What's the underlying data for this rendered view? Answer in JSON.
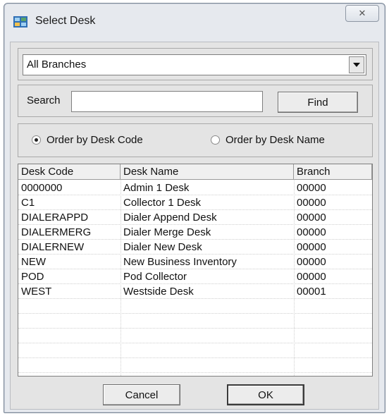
{
  "window": {
    "title": "Select Desk",
    "close_symbol": "✕",
    "app_icon": "desk-app-icon"
  },
  "branch_select": {
    "selected": "All Branches",
    "arrow_icon": "dropdown-arrow-icon"
  },
  "search": {
    "label": "Search",
    "value": "",
    "find_label": "Find"
  },
  "order": {
    "options": [
      {
        "label": "Order by Desk Code",
        "checked": true
      },
      {
        "label": "Order by Desk Name",
        "checked": false
      }
    ]
  },
  "table": {
    "columns": [
      "Desk Code",
      "Desk Name",
      "Branch"
    ],
    "rows": [
      [
        "0000000",
        "Admin 1 Desk",
        "00000"
      ],
      [
        "C1",
        "Collector 1 Desk",
        "00000"
      ],
      [
        "DIALERAPPD",
        "Dialer Append Desk",
        "00000"
      ],
      [
        "DIALERMERG",
        "Dialer Merge Desk",
        "00000"
      ],
      [
        "DIALERNEW",
        "Dialer New Desk",
        "00000"
      ],
      [
        "NEW",
        "New Business Inventory",
        "00000"
      ],
      [
        "POD",
        "Pod Collector",
        "00000"
      ],
      [
        "WEST",
        "Westside Desk",
        "00001"
      ]
    ]
  },
  "buttons": {
    "cancel_label": "Cancel",
    "ok_label": "OK"
  }
}
